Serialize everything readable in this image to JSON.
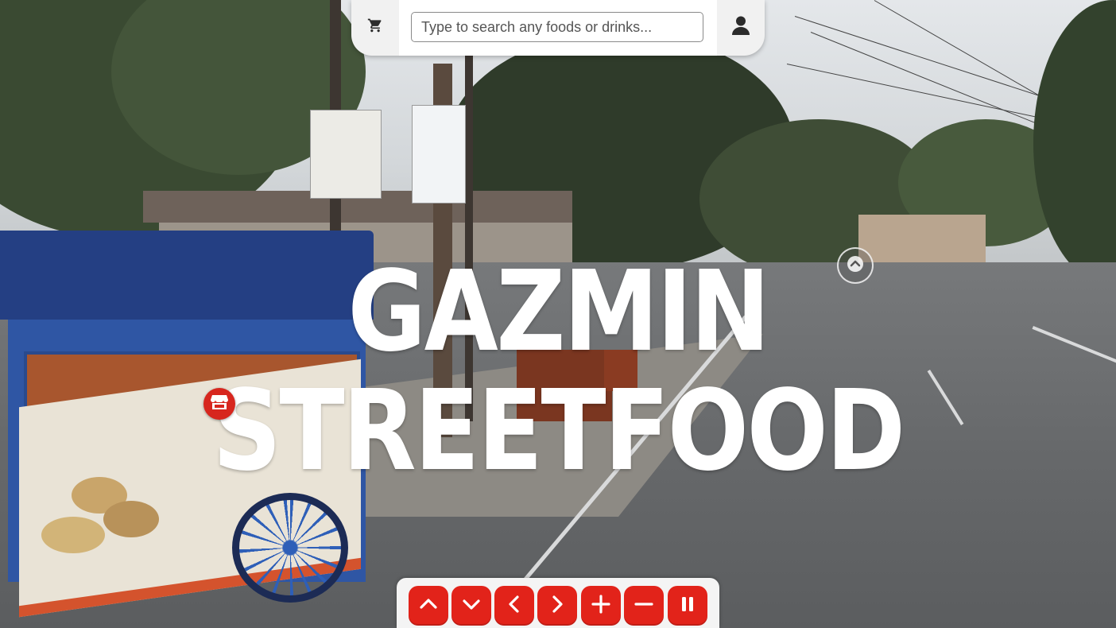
{
  "title": "GAZMIN STREETFOOD",
  "search": {
    "placeholder": "Type to search any foods or drinks...",
    "value": ""
  },
  "header": {
    "cart_icon": "shopping-cart-icon",
    "user_icon": "user-icon"
  },
  "hotspots": {
    "store_icon": "store-icon",
    "navigate_icon": "chevron-up-icon"
  },
  "controls": [
    {
      "name": "move-up-button",
      "icon": "chevron-up-icon"
    },
    {
      "name": "move-down-button",
      "icon": "chevron-down-icon"
    },
    {
      "name": "move-left-button",
      "icon": "chevron-left-icon"
    },
    {
      "name": "move-right-button",
      "icon": "chevron-right-icon"
    },
    {
      "name": "zoom-in-button",
      "icon": "plus-icon"
    },
    {
      "name": "zoom-out-button",
      "icon": "minus-icon"
    },
    {
      "name": "pause-button",
      "icon": "pause-icon"
    }
  ],
  "colors": {
    "accent": "#e2231a",
    "marker": "#d7261e",
    "title": "#ffffff"
  }
}
